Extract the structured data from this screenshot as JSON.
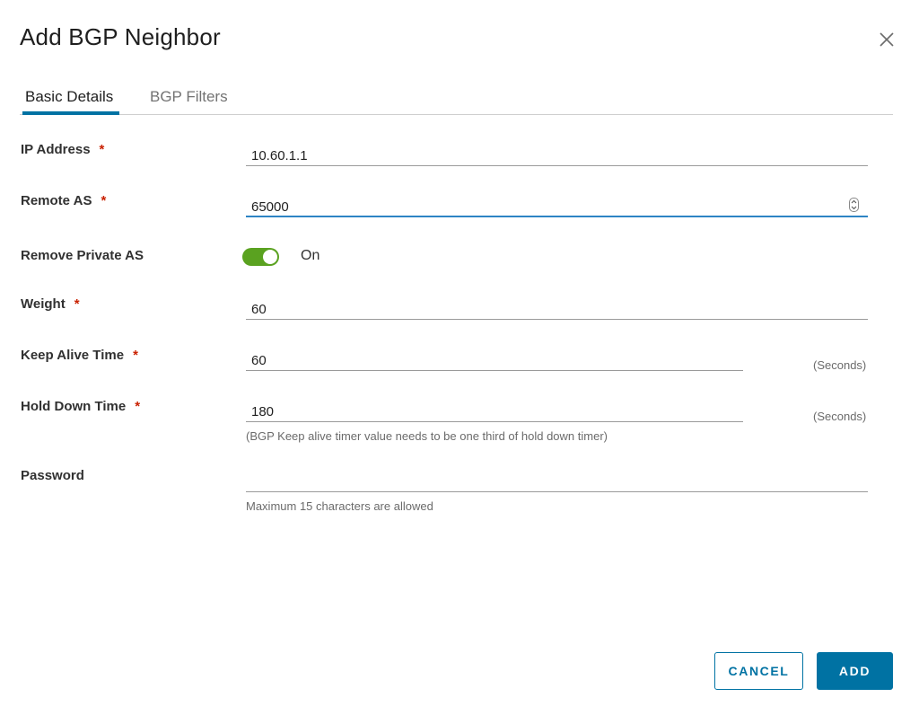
{
  "dialog": {
    "title": "Add BGP Neighbor",
    "close_icon": "close-icon"
  },
  "tabs": [
    {
      "label": "Basic Details",
      "active": true
    },
    {
      "label": "BGP Filters",
      "active": false
    }
  ],
  "form": {
    "ip_address": {
      "label": "IP Address",
      "required": "*",
      "value": "10.60.1.1"
    },
    "remote_as": {
      "label": "Remote AS",
      "required": "*",
      "value": "65000"
    },
    "remove_private_as": {
      "label": "Remove Private AS",
      "state": "On",
      "enabled": true
    },
    "weight": {
      "label": "Weight",
      "required": "*",
      "value": "60"
    },
    "keep_alive_time": {
      "label": "Keep Alive Time",
      "required": "*",
      "value": "60",
      "unit": "(Seconds)"
    },
    "hold_down_time": {
      "label": "Hold Down Time",
      "required": "*",
      "value": "180",
      "unit": "(Seconds)",
      "hint": "(BGP Keep alive timer value needs to be one third of hold down timer)"
    },
    "password": {
      "label": "Password",
      "value": "",
      "hint": "Maximum 15 characters are allowed"
    }
  },
  "buttons": {
    "cancel": "CANCEL",
    "add": "ADD"
  },
  "colors": {
    "primary": "#0072a3",
    "toggle_on": "#5aa220",
    "required": "#c92100",
    "focus": "#2e84c4"
  }
}
